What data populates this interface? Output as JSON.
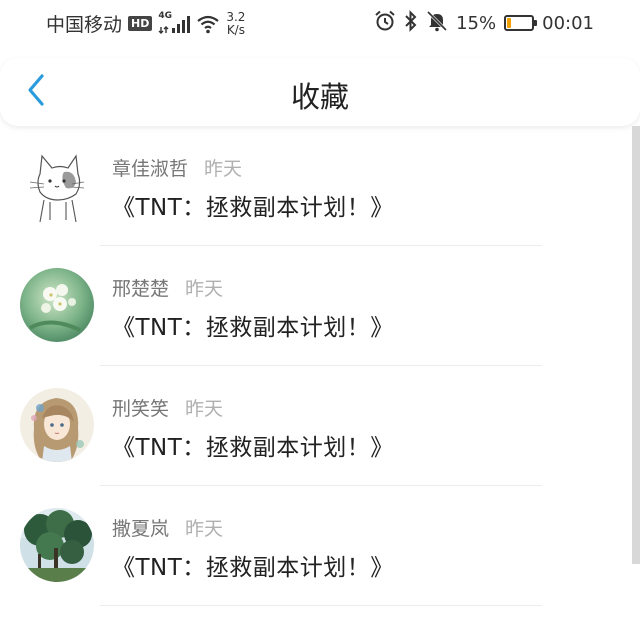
{
  "status_bar": {
    "carrier": "中国移动",
    "hd": "HD",
    "network": "4G",
    "speed_value": "3.2",
    "speed_unit": "K/s",
    "battery_percent": "15%",
    "battery_level": 0.15,
    "time": "00:01",
    "icons": [
      "alarm-icon",
      "bluetooth-icon",
      "mute-icon"
    ]
  },
  "header": {
    "title": "收藏",
    "back_icon": "chevron-left-icon",
    "accent_color": "#2a9bdc"
  },
  "items": [
    {
      "author": "章佳淑哲",
      "time": "昨天",
      "title": "《TNT：拯救副本计划！》",
      "avatar": "cat-sketch"
    },
    {
      "author": "邢楚楚",
      "time": "昨天",
      "title": "《TNT：拯救副本计划！》",
      "avatar": "white-flowers"
    },
    {
      "author": "刑笑笑",
      "time": "昨天",
      "title": "《TNT：拯救副本计划！》",
      "avatar": "anime-girl"
    },
    {
      "author": "撒夏岚",
      "time": "昨天",
      "title": "《TNT：拯救副本计划！》",
      "avatar": "trees"
    }
  ]
}
